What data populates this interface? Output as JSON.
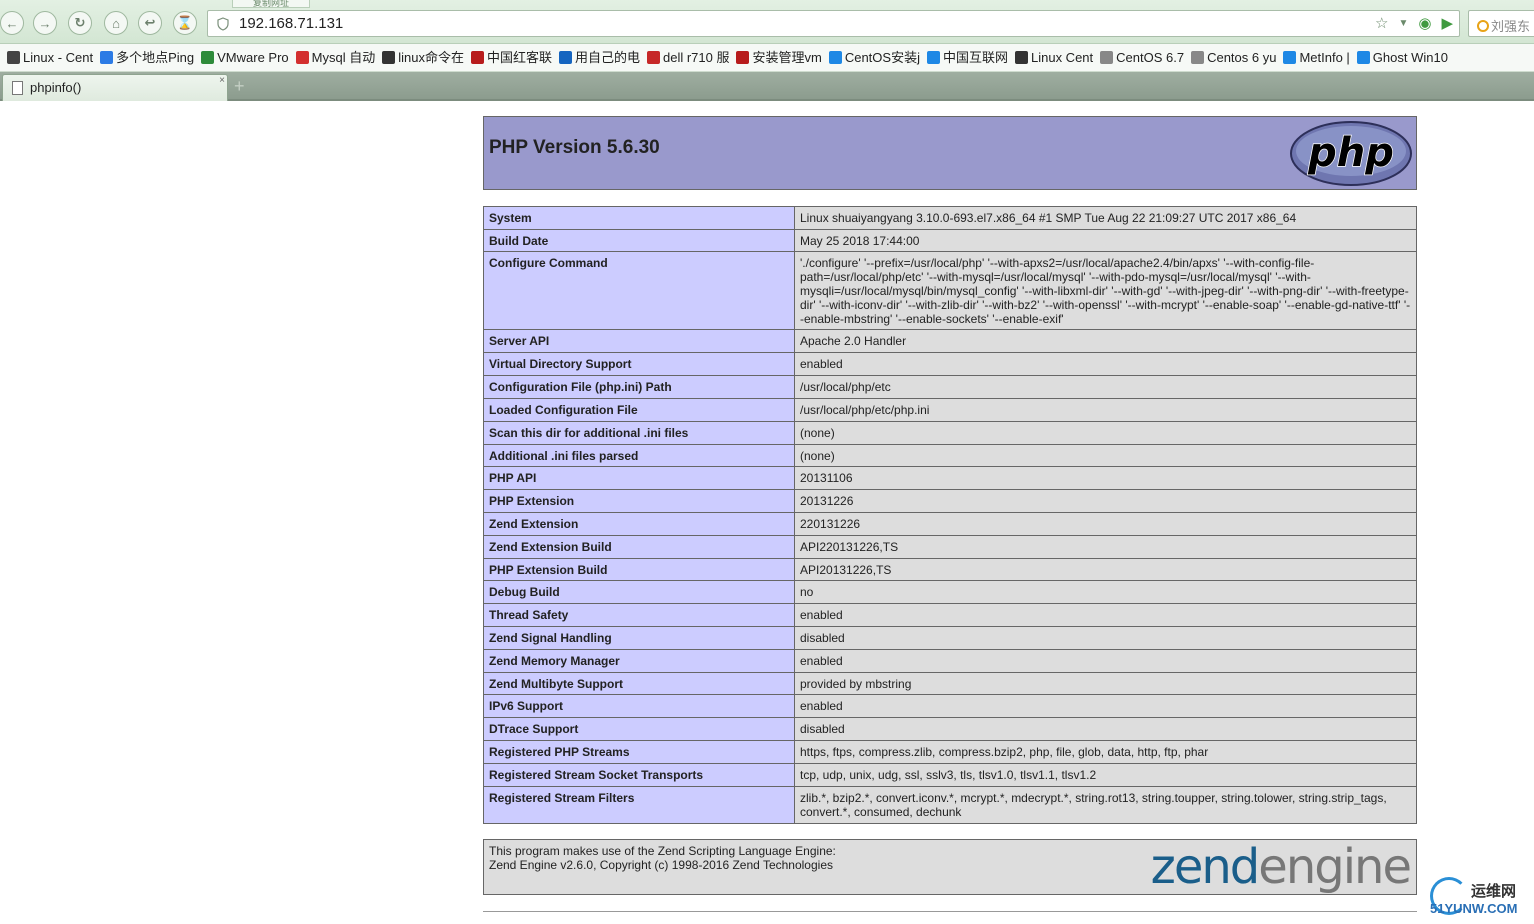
{
  "browser": {
    "hint_tab": "复制网址",
    "address": "192.168.71.131",
    "search_placeholder": "刘强东",
    "tab_title": "phpinfo()",
    "new_tab": "+",
    "tab_close": "×"
  },
  "bookmarks": [
    {
      "label": "Linux - Cent",
      "color": "#444444"
    },
    {
      "label": "多个地点Ping",
      "color": "#2c7be5"
    },
    {
      "label": "VMware Pro",
      "color": "#2e8b3a"
    },
    {
      "label": "Mysql 自动",
      "color": "#d32f2f"
    },
    {
      "label": "linux命令在",
      "color": "#333333"
    },
    {
      "label": "中国红客联",
      "color": "#b71c1c"
    },
    {
      "label": "用自己的电",
      "color": "#1565c0"
    },
    {
      "label": "dell r710 服",
      "color": "#c62828"
    },
    {
      "label": "安装管理vm",
      "color": "#b71c1c"
    },
    {
      "label": "CentOS安装j",
      "color": "#1e88e5"
    },
    {
      "label": "中国互联网",
      "color": "#1e88e5"
    },
    {
      "label": "Linux Cent",
      "color": "#333333"
    },
    {
      "label": "CentOS 6.7",
      "color": "#888888"
    },
    {
      "label": "Centos 6 yu",
      "color": "#888888"
    },
    {
      "label": "MetInfo |",
      "color": "#1e88e5"
    },
    {
      "label": "Ghost Win10",
      "color": "#1e88e5"
    }
  ],
  "header": {
    "title": "PHP Version 5.6.30",
    "logo_text": "php"
  },
  "rows": [
    {
      "key": "System",
      "value": "Linux shuaiyangyang 3.10.0-693.el7.x86_64 #1 SMP Tue Aug 22 21:09:27 UTC 2017 x86_64"
    },
    {
      "key": "Build Date",
      "value": "May 25 2018 17:44:00"
    },
    {
      "key": "Configure Command",
      "value": "'./configure' '--prefix=/usr/local/php' '--with-apxs2=/usr/local/apache2.4/bin/apxs' '--with-config-file-path=/usr/local/php/etc' '--with-mysql=/usr/local/mysql' '--with-pdo-mysql=/usr/local/mysql' '--with-mysqli=/usr/local/mysql/bin/mysql_config' '--with-libxml-dir' '--with-gd' '--with-jpeg-dir' '--with-png-dir' '--with-freetype-dir' '--with-iconv-dir' '--with-zlib-dir' '--with-bz2' '--with-openssl' '--with-mcrypt' '--enable-soap' '--enable-gd-native-ttf' '--enable-mbstring' '--enable-sockets' '--enable-exif'"
    },
    {
      "key": "Server API",
      "value": "Apache 2.0 Handler"
    },
    {
      "key": "Virtual Directory Support",
      "value": "enabled"
    },
    {
      "key": "Configuration File (php.ini) Path",
      "value": "/usr/local/php/etc"
    },
    {
      "key": "Loaded Configuration File",
      "value": "/usr/local/php/etc/php.ini"
    },
    {
      "key": "Scan this dir for additional .ini files",
      "value": "(none)"
    },
    {
      "key": "Additional .ini files parsed",
      "value": "(none)"
    },
    {
      "key": "PHP API",
      "value": "20131106"
    },
    {
      "key": "PHP Extension",
      "value": "20131226"
    },
    {
      "key": "Zend Extension",
      "value": "220131226"
    },
    {
      "key": "Zend Extension Build",
      "value": "API220131226,TS"
    },
    {
      "key": "PHP Extension Build",
      "value": "API20131226,TS"
    },
    {
      "key": "Debug Build",
      "value": "no"
    },
    {
      "key": "Thread Safety",
      "value": "enabled"
    },
    {
      "key": "Zend Signal Handling",
      "value": "disabled"
    },
    {
      "key": "Zend Memory Manager",
      "value": "enabled"
    },
    {
      "key": "Zend Multibyte Support",
      "value": "provided by mbstring"
    },
    {
      "key": "IPv6 Support",
      "value": "enabled"
    },
    {
      "key": "DTrace Support",
      "value": "disabled"
    },
    {
      "key": "Registered PHP Streams",
      "value": "https, ftps, compress.zlib, compress.bzip2, php, file, glob, data, http, ftp, phar"
    },
    {
      "key": "Registered Stream Socket Transports",
      "value": "tcp, udp, unix, udg, ssl, sslv3, tls, tlsv1.0, tlsv1.1, tlsv1.2"
    },
    {
      "key": "Registered Stream Filters",
      "value": "zlib.*, bzip2.*, convert.iconv.*, mcrypt.*, mdecrypt.*, string.rot13, string.toupper, string.tolower, string.strip_tags, convert.*, consumed, dechunk"
    }
  ],
  "zend": {
    "line1": "This program makes use of the Zend Scripting Language Engine:",
    "line2": "Zend Engine v2.6.0, Copyright (c) 1998-2016 Zend Technologies",
    "logo_zend": "zend",
    "logo_engine": "engine"
  },
  "watermark": {
    "cn": "运维网",
    "en": "51YUNW.COM"
  },
  "colors": {
    "header_bg": "#9999cc",
    "key_bg": "#ccccff",
    "value_bg": "#dddddd"
  }
}
